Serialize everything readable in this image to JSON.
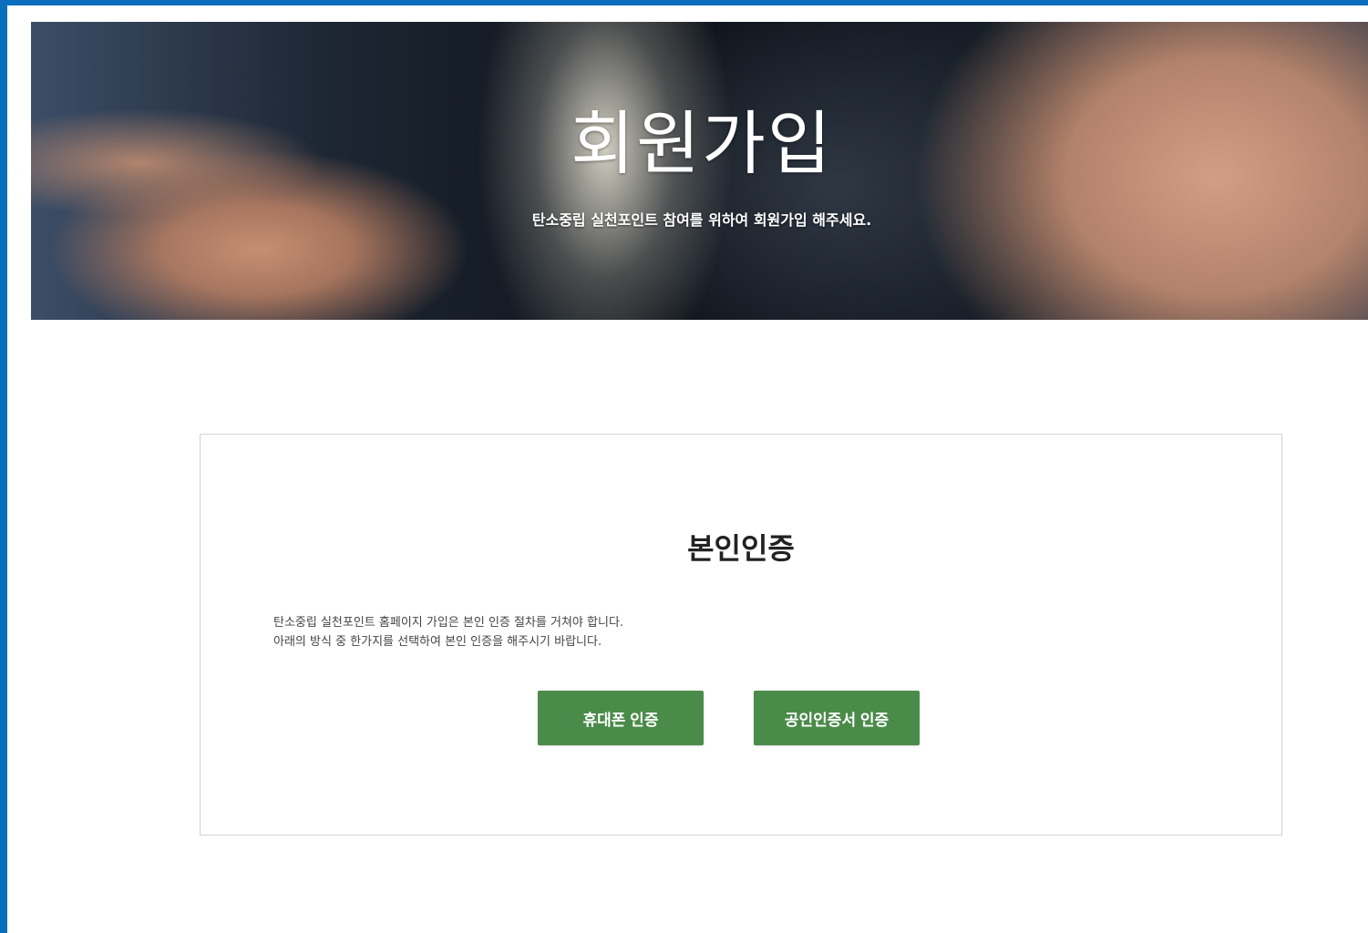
{
  "hero": {
    "title": "회원가입",
    "subtitle": "탄소중립 실천포인트 참여를 위하여 회원가입 해주세요."
  },
  "verification": {
    "title": "본인인증",
    "description_lines": [
      "탄소중립 실천포인트 홈페이지 가입은 본인 인증 절차를 거쳐야 합니다.",
      "아래의 방식 중 한가지를 선택하여 본인 인증을 해주시기 바랍니다."
    ],
    "buttons": {
      "phone_label": "휴대폰 인증",
      "certificate_label": "공인인증서 인증"
    }
  },
  "colors": {
    "accent_green": "#4a8b4a",
    "frame_blue": "#0a6ebd"
  }
}
